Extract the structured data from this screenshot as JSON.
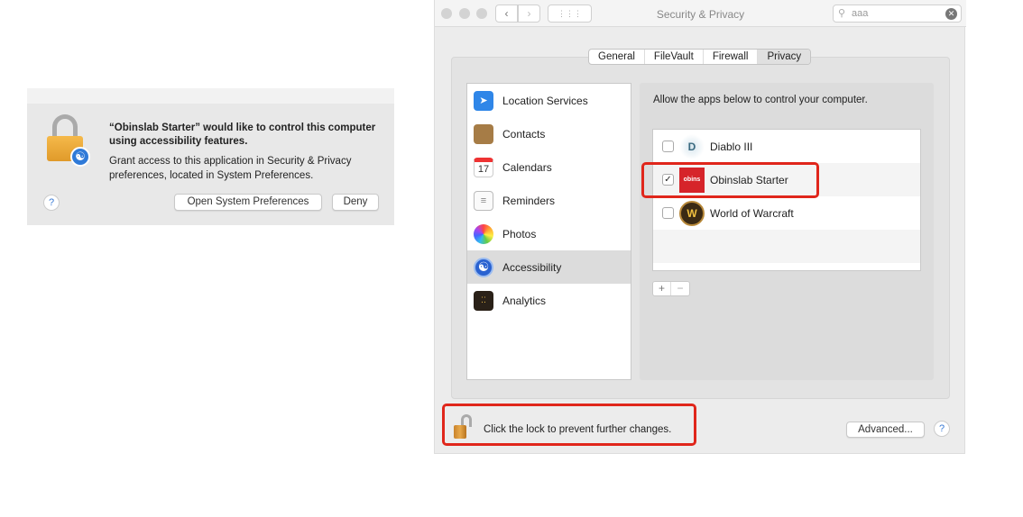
{
  "dialog": {
    "title": "“Obinslab Starter” would like to control this computer using accessibility features.",
    "message": "Grant access to this application in Security & Privacy preferences, located in System Preferences.",
    "open_button": "Open System Preferences",
    "deny_button": "Deny",
    "help": "?"
  },
  "window": {
    "title": "Security & Privacy",
    "search_value": "aaa",
    "tabs": [
      {
        "label": "General",
        "selected": false
      },
      {
        "label": "FileVault",
        "selected": false
      },
      {
        "label": "Firewall",
        "selected": false
      },
      {
        "label": "Privacy",
        "selected": true
      }
    ],
    "sidebar": {
      "items": [
        {
          "label": "Location Services",
          "icon": "location-arrow-icon"
        },
        {
          "label": "Contacts",
          "icon": "contacts-book-icon"
        },
        {
          "label": "Calendars",
          "icon": "calendar-icon",
          "icon_text": "17"
        },
        {
          "label": "Reminders",
          "icon": "reminders-icon"
        },
        {
          "label": "Photos",
          "icon": "photos-icon"
        },
        {
          "label": "Accessibility",
          "icon": "accessibility-icon",
          "selected": true
        },
        {
          "label": "Analytics",
          "icon": "analytics-icon"
        }
      ]
    },
    "panel": {
      "instruction": "Allow the apps below to control your computer.",
      "apps": [
        {
          "name": "Diablo III",
          "checked": false,
          "icon": "diablo-icon"
        },
        {
          "name": "Obinslab Starter",
          "checked": true,
          "icon": "obinslab-icon",
          "icon_text": "obins"
        },
        {
          "name": "World of Warcraft",
          "checked": false,
          "icon": "warcraft-icon",
          "icon_text": "W"
        }
      ],
      "add": "+",
      "remove": "−"
    },
    "lock_text": "Click the lock to prevent further changes.",
    "advanced_button": "Advanced...",
    "help": "?"
  },
  "colors": {
    "highlight": "#e0261b",
    "accent": "#3a7bd5"
  }
}
